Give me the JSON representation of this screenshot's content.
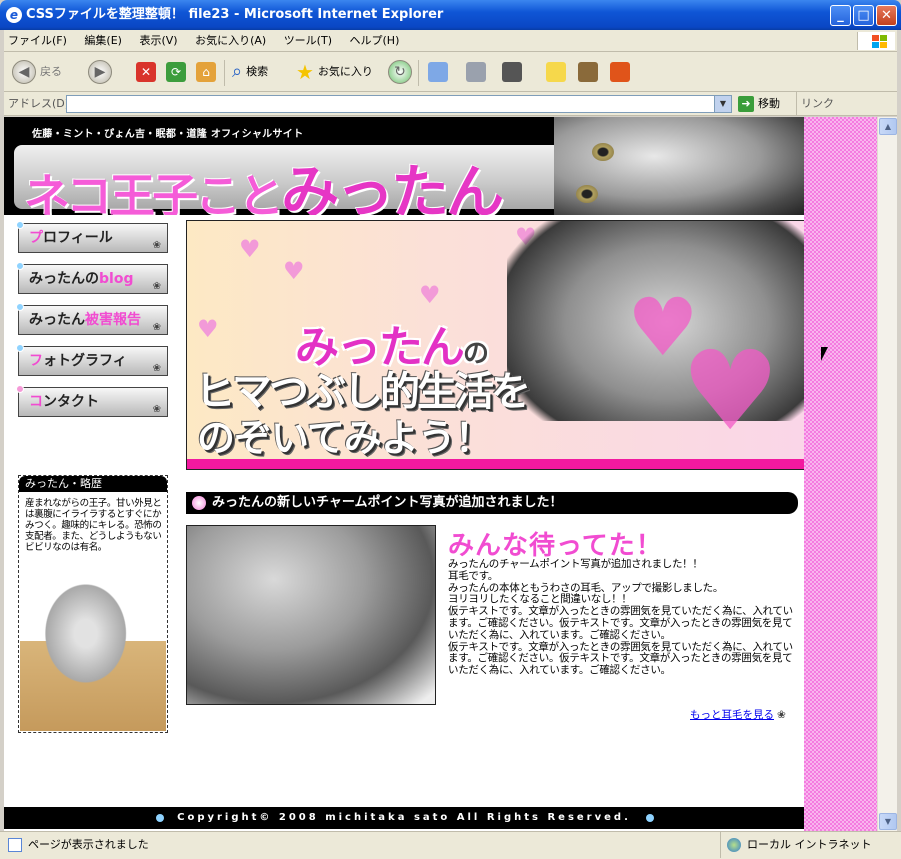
{
  "window": {
    "title": "CSSファイルを整理整頓！ file23 - Microsoft Internet Explorer",
    "app_icon_glyph": "e",
    "min_glyph": "_",
    "max_glyph": "□",
    "close_glyph": "✕"
  },
  "menu": [
    "ファイル(F)",
    "編集(E)",
    "表示(V)",
    "お気に入り(A)",
    "ツール(T)",
    "ヘルプ(H)"
  ],
  "toolbar": {
    "back": "戻る",
    "back_glyph": "◀",
    "forward_glyph": "▶",
    "search": "検索",
    "search_glyph": "⌕",
    "favorites": "お気に入り",
    "favorites_glyph": "★",
    "history_glyph": "↻",
    "stop_glyph": "✕",
    "refresh_glyph": "⟳",
    "home_glyph": "⌂"
  },
  "address": {
    "label": "アドレス(D)",
    "value": "",
    "go": "移動",
    "go_glyph": "➜",
    "links": "リンク",
    "drop_glyph": "▼"
  },
  "site": {
    "subtitle": "佐藤・ミント・ぴょん吉・眠都・道隆 オフィシャルサイト",
    "title_a": "ネコ王子こと",
    "title_b": "みったん",
    "nav": [
      {
        "hl": "プ",
        "rest": "ロフィール"
      },
      {
        "hl": "みったんの",
        "rest": "blog"
      },
      {
        "hl": "みったん",
        "rest": "被害報告"
      },
      {
        "hl": "フ",
        "rest": "ォトグラフィ"
      },
      {
        "hl": "コ",
        "rest": "ンタクト"
      }
    ],
    "paw_glyph": "❀",
    "hero": {
      "line1": "みったん",
      "line1_suffix": "の",
      "line2": "ヒマつぶし的生活を",
      "line3": "のぞいてみよう！",
      "heart_glyph": "♥"
    },
    "profile": {
      "heading": "みったん・略歴",
      "text": "産まれながらの王子。甘い外見とは裏腹にイライラするとすぐにかみつく。趣味的にキレる。恐怖の支配者。また、どうしようもないビビリなのは有名。"
    },
    "news": {
      "heading": "みったんの新しいチャームポイント写真が追加されました！",
      "title": "みんな待ってた！",
      "lines": [
        "みったんのチャームポイント写真が追加されました！！",
        "耳毛です。",
        "みったんの本体ともうわさの耳毛、アップで撮影しました。",
        "ヨリヨリしたくなること間違いなし！！",
        "仮テキストです。文章が入ったときの雰囲気を見ていただく為に、入れています。ご確認ください。仮テキストです。文章が入ったときの雰囲気を見ていただく為に、入れています。ご確認ください。",
        "仮テキストです。文章が入ったときの雰囲気を見ていただく為に、入れています。ご確認ください。仮テキストです。文章が入ったときの雰囲気を見ていただく為に、入れています。ご確認ください。"
      ],
      "more": "もっと耳毛を見る"
    },
    "footer": "Copyright© 2008 michitaka sato All Rights Reserved."
  },
  "status": {
    "left": "ページが表示されました",
    "right": "ローカル イントラネット"
  },
  "colors": {
    "accent_pink": "#f14cd1",
    "ie_blue": "#0f56d6"
  }
}
